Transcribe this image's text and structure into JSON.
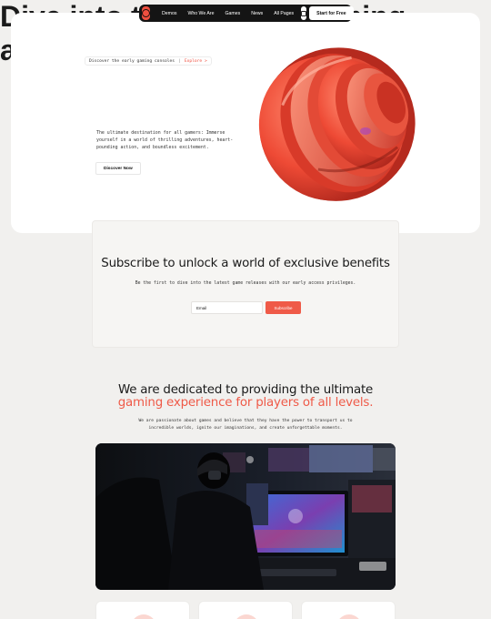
{
  "nav": {
    "items": [
      "Demos",
      "Who We Are",
      "Games",
      "News",
      "All Pages"
    ],
    "cta": "Start for Free"
  },
  "hero": {
    "tagline": "Discover the early gaming consoles",
    "separator": "|",
    "explore": "Explore >",
    "title": "Dive into the ultimate gaming adventure",
    "description": "The ultimate destination for all gamers: Immerse yourself in a world of thrilling adventures, heart-pounding action, and boundless excitement.",
    "button": "Discover Now"
  },
  "subscribe": {
    "title": "Subscribe to unlock a world of exclusive benefits",
    "text": "Be the first to dive into the latest game releases with our early access privileges.",
    "email_placeholder": "Email",
    "button": "Subscribe"
  },
  "dedicated": {
    "line1": "We are dedicated to providing the ultimate",
    "line2": "gaming experience for players of all levels.",
    "text": "We are passionate about games and believe that they have the power to transport us to incredible worlds, ignite our imaginations, and create unforgettable moments."
  },
  "colors": {
    "accent": "#ef5a48",
    "nav_bg": "#141414",
    "page_bg": "#f1f0ee"
  }
}
